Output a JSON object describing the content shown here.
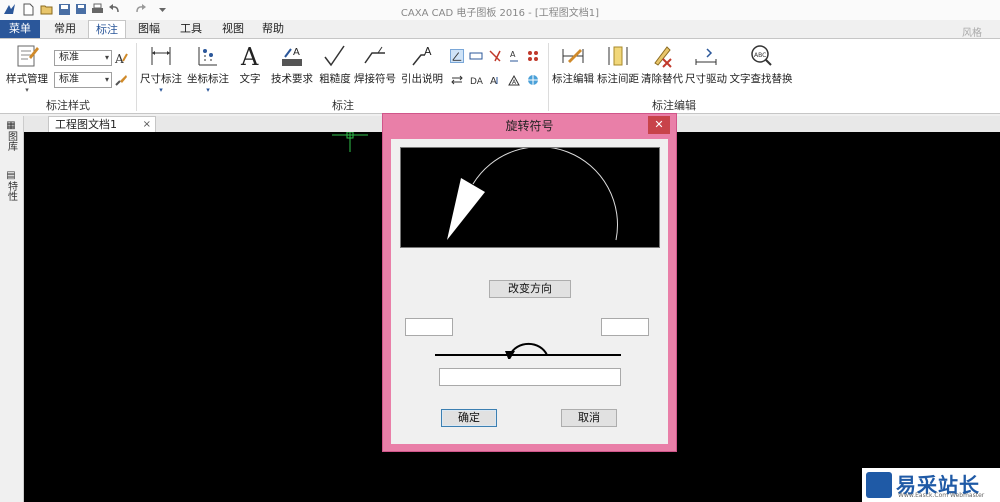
{
  "window": {
    "title": "CAXA CAD 电子图板 2016 - [工程图文档1]",
    "style_label": "风格"
  },
  "tabs": [
    {
      "label": "菜单"
    },
    {
      "label": "常用"
    },
    {
      "label": "标注"
    },
    {
      "label": "图幅"
    },
    {
      "label": "工具"
    },
    {
      "label": "视图"
    },
    {
      "label": "帮助"
    }
  ],
  "ribbon": {
    "style_group": {
      "label": "标注样式",
      "style_manage": "样式管理",
      "combo1": "标准",
      "combo2": "标准"
    },
    "annot_group": {
      "label": "标注",
      "buttons": [
        {
          "label": "尺寸标注"
        },
        {
          "label": "坐标标注"
        },
        {
          "label": "文字"
        },
        {
          "label": "技术要求"
        },
        {
          "label": "粗糙度"
        },
        {
          "label": "焊接符号"
        },
        {
          "label": "引出说明"
        }
      ]
    },
    "edit_group": {
      "label": "标注编辑",
      "buttons": [
        {
          "label": "标注编辑"
        },
        {
          "label": "标注间距"
        },
        {
          "label": "清除替代"
        },
        {
          "label": "尺寸驱动"
        },
        {
          "label": "文字查找替换"
        }
      ]
    }
  },
  "document_tab": {
    "label": "工程图文档1",
    "close": "×"
  },
  "side_panel": {
    "tab1": "图库",
    "tab2": "特性"
  },
  "dialog": {
    "title": "旋转符号",
    "close": "✕",
    "change_direction": "改变方向",
    "left_field": "",
    "right_field": "",
    "bottom_field": "",
    "ok": "确定",
    "cancel": "取消"
  },
  "watermark": {
    "text": "易采站长站",
    "sub": "Www.Easck.Com Webmaster"
  },
  "colors": {
    "accent": "#2b579a",
    "dialog_frame": "#e97fa8",
    "close_red": "#c8434a"
  }
}
